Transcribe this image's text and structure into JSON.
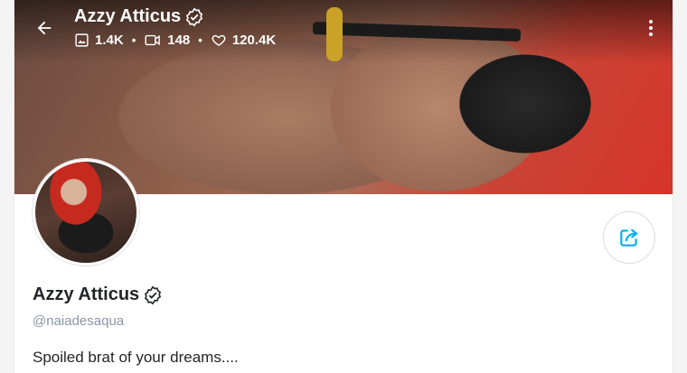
{
  "profile": {
    "name": "Azzy Atticus",
    "username": "@naiadesaqua",
    "bio": "Spoiled brat of your dreams....",
    "verified": true
  },
  "stats": {
    "photos": "1.4K",
    "videos": "148",
    "likes": "120.4K"
  },
  "icons": {
    "back": "arrow-left-icon",
    "photos": "image-icon",
    "videos": "video-icon",
    "likes": "heart-icon",
    "verified": "verified-badge-icon",
    "more": "more-vertical-icon",
    "share": "share-icon"
  },
  "colors": {
    "accent": "#00aff0",
    "text": "#242529",
    "muted": "#8a96a3"
  }
}
